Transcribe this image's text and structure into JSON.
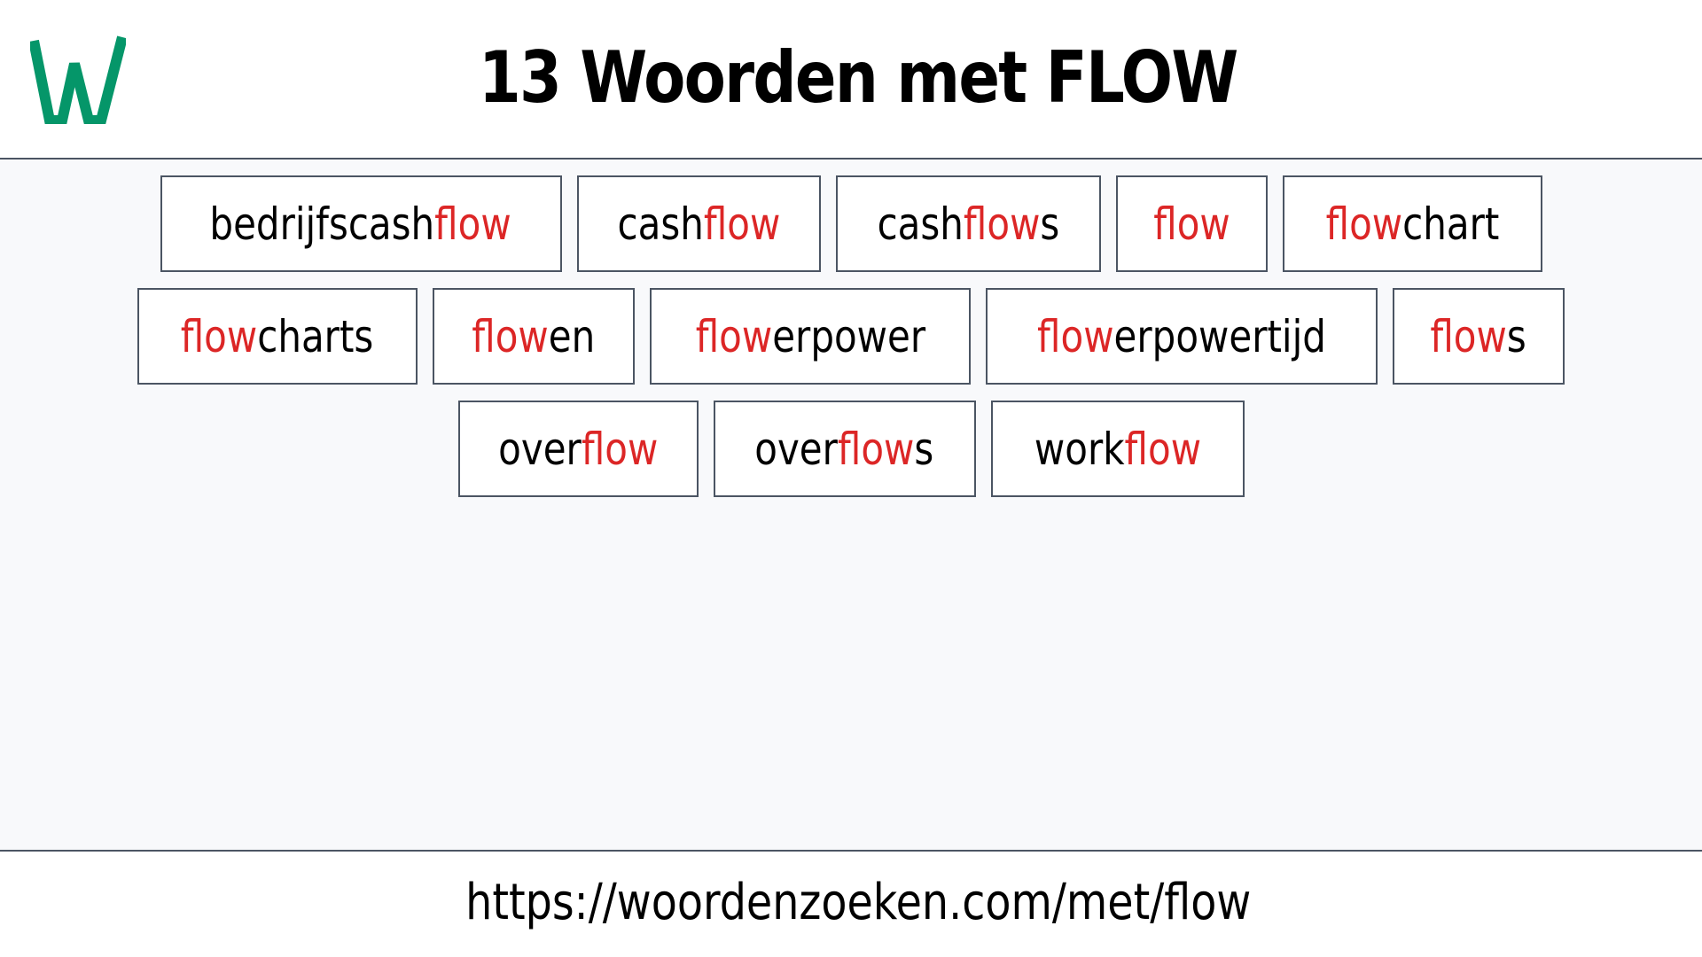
{
  "header": {
    "logo_letter": "W",
    "logo_color": "#059669",
    "title": "13 Woorden met FLOW"
  },
  "highlight_color": "#dc2626",
  "rows": [
    [
      {
        "prefix": "bedrijfscash",
        "match": "flow",
        "suffix": ""
      },
      {
        "prefix": "cash",
        "match": "flow",
        "suffix": ""
      },
      {
        "prefix": "cash",
        "match": "flow",
        "suffix": "s"
      },
      {
        "prefix": "",
        "match": "flow",
        "suffix": ""
      },
      {
        "prefix": "",
        "match": "flow",
        "suffix": "chart"
      }
    ],
    [
      {
        "prefix": "",
        "match": "flow",
        "suffix": "charts"
      },
      {
        "prefix": "",
        "match": "flow",
        "suffix": "en"
      },
      {
        "prefix": "",
        "match": "flow",
        "suffix": "erpower"
      },
      {
        "prefix": "",
        "match": "flow",
        "suffix": "erpowertijd"
      },
      {
        "prefix": "",
        "match": "flow",
        "suffix": "s"
      }
    ],
    [
      {
        "prefix": "over",
        "match": "flow",
        "suffix": ""
      },
      {
        "prefix": "over",
        "match": "flow",
        "suffix": "s"
      },
      {
        "prefix": "work",
        "match": "flow",
        "suffix": ""
      }
    ]
  ],
  "footer": {
    "url": "https://woordenzoeken.com/met/flow"
  }
}
